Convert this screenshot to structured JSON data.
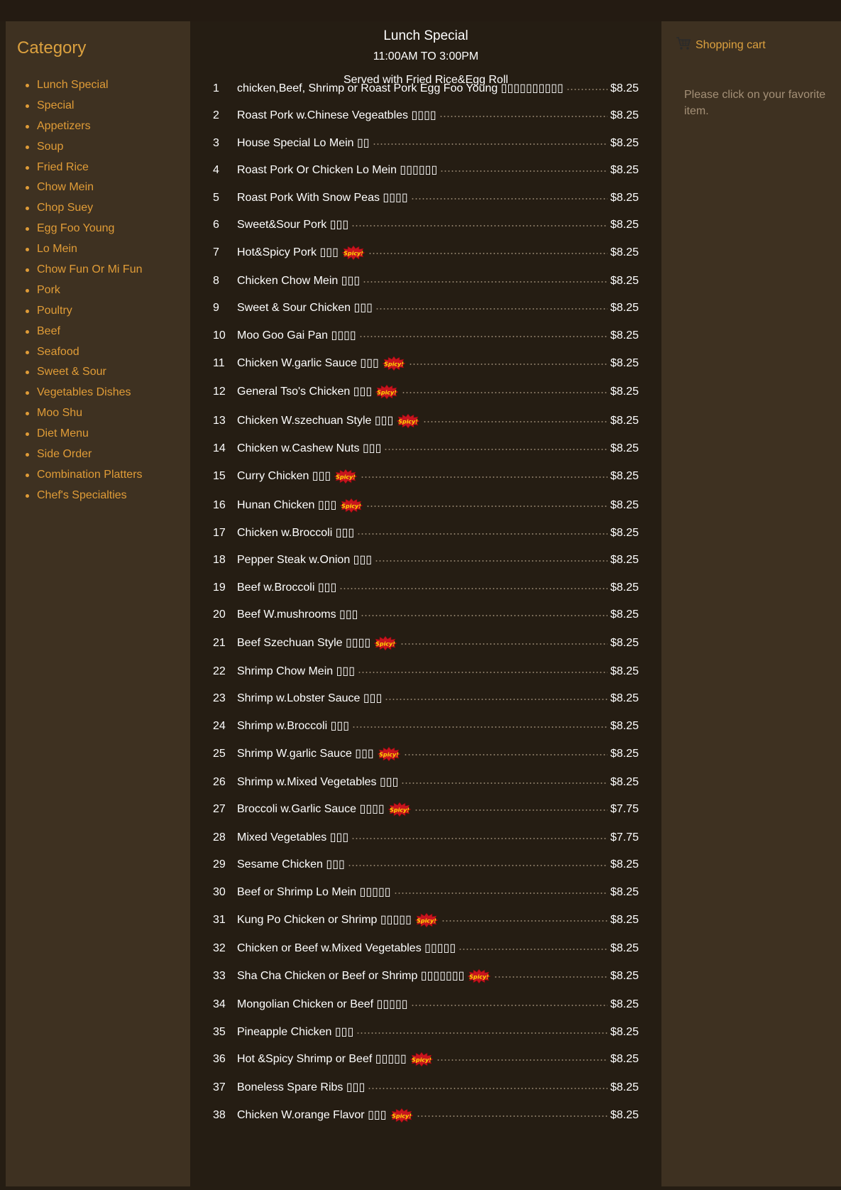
{
  "sidebar": {
    "heading": "Category",
    "items": [
      "Lunch Special",
      "Special",
      "Appetizers",
      "Soup",
      "Fried Rice",
      "Chow Mein",
      "Chop Suey",
      "Egg Foo Young",
      "Lo Mein",
      "Chow Fun Or Mi Fun",
      "Pork",
      "Poultry",
      "Beef",
      "Seafood",
      "Sweet & Sour",
      "Vegetables Dishes",
      "Moo Shu",
      "Diet Menu",
      "Side Order",
      "Combination Platters",
      "Chef's Specialties"
    ]
  },
  "main": {
    "title": "Lunch Special",
    "hours": "11:00AM TO 3:00PM",
    "served": "Served with Fried Rice&Egg Roll",
    "spicy_label": "Spicy!",
    "items": [
      {
        "num": "1",
        "name": "chicken,Beef, Shrimp or Roast Pork Egg Foo Young ▯▯▯▯▯▯▯▯▯▯",
        "price": "$8.25",
        "spicy": false
      },
      {
        "num": "2",
        "name": "Roast Pork w.Chinese Vegeatbles ▯▯▯▯",
        "price": "$8.25",
        "spicy": false
      },
      {
        "num": "3",
        "name": "House Special Lo Mein ▯▯",
        "price": "$8.25",
        "spicy": false
      },
      {
        "num": "4",
        "name": "Roast Pork Or Chicken Lo Mein ▯▯▯▯▯▯",
        "price": "$8.25",
        "spicy": false
      },
      {
        "num": "5",
        "name": "Roast Pork With Snow Peas ▯▯▯▯",
        "price": "$8.25",
        "spicy": false
      },
      {
        "num": "6",
        "name": "Sweet&Sour Pork ▯▯▯",
        "price": "$8.25",
        "spicy": false
      },
      {
        "num": "7",
        "name": "Hot&Spicy Pork ▯▯▯",
        "price": "$8.25",
        "spicy": true
      },
      {
        "num": "8",
        "name": "Chicken Chow Mein ▯▯▯",
        "price": "$8.25",
        "spicy": false
      },
      {
        "num": "9",
        "name": "Sweet & Sour Chicken ▯▯▯",
        "price": "$8.25",
        "spicy": false
      },
      {
        "num": "10",
        "name": "Moo Goo Gai Pan ▯▯▯▯",
        "price": "$8.25",
        "spicy": false
      },
      {
        "num": "11",
        "name": "Chicken W.garlic Sauce ▯▯▯",
        "price": "$8.25",
        "spicy": true
      },
      {
        "num": "12",
        "name": "General Tso's Chicken ▯▯▯",
        "price": "$8.25",
        "spicy": true
      },
      {
        "num": "13",
        "name": "Chicken W.szechuan Style ▯▯▯",
        "price": "$8.25",
        "spicy": true
      },
      {
        "num": "14",
        "name": "Chicken w.Cashew Nuts ▯▯▯",
        "price": "$8.25",
        "spicy": false
      },
      {
        "num": "15",
        "name": "Curry Chicken ▯▯▯",
        "price": "$8.25",
        "spicy": true
      },
      {
        "num": "16",
        "name": "Hunan Chicken ▯▯▯",
        "price": "$8.25",
        "spicy": true
      },
      {
        "num": "17",
        "name": "Chicken w.Broccoli ▯▯▯",
        "price": "$8.25",
        "spicy": false
      },
      {
        "num": "18",
        "name": "Pepper Steak w.Onion ▯▯▯",
        "price": "$8.25",
        "spicy": false
      },
      {
        "num": "19",
        "name": "Beef w.Broccoli ▯▯▯",
        "price": "$8.25",
        "spicy": false
      },
      {
        "num": "20",
        "name": "Beef W.mushrooms ▯▯▯",
        "price": "$8.25",
        "spicy": false
      },
      {
        "num": "21",
        "name": "Beef Szechuan Style ▯▯▯▯",
        "price": "$8.25",
        "spicy": true
      },
      {
        "num": "22",
        "name": "Shrimp Chow Mein ▯▯▯",
        "price": "$8.25",
        "spicy": false
      },
      {
        "num": "23",
        "name": "Shrimp w.Lobster Sauce ▯▯▯",
        "price": "$8.25",
        "spicy": false
      },
      {
        "num": "24",
        "name": "Shrimp w.Broccoli ▯▯▯",
        "price": "$8.25",
        "spicy": false
      },
      {
        "num": "25",
        "name": "Shrimp W.garlic Sauce ▯▯▯",
        "price": "$8.25",
        "spicy": true
      },
      {
        "num": "26",
        "name": "Shrimp w.Mixed Vegetables ▯▯▯",
        "price": "$8.25",
        "spicy": false
      },
      {
        "num": "27",
        "name": "Broccoli w.Garlic Sauce ▯▯▯▯",
        "price": "$7.75",
        "spicy": true
      },
      {
        "num": "28",
        "name": "Mixed Vegetables ▯▯▯",
        "price": "$7.75",
        "spicy": false
      },
      {
        "num": "29",
        "name": "Sesame Chicken ▯▯▯",
        "price": "$8.25",
        "spicy": false
      },
      {
        "num": "30",
        "name": "Beef or Shrimp Lo Mein ▯▯▯▯▯",
        "price": "$8.25",
        "spicy": false
      },
      {
        "num": "31",
        "name": "Kung Po Chicken or Shrimp ▯▯▯▯▯",
        "price": "$8.25",
        "spicy": true
      },
      {
        "num": "32",
        "name": "Chicken or Beef w.Mixed Vegetables ▯▯▯▯▯",
        "price": "$8.25",
        "spicy": false
      },
      {
        "num": "33",
        "name": "Sha Cha Chicken or Beef or Shrimp ▯▯▯▯▯▯▯",
        "price": "$8.25",
        "spicy": true
      },
      {
        "num": "34",
        "name": "Mongolian Chicken or Beef ▯▯▯▯▯",
        "price": "$8.25",
        "spicy": false
      },
      {
        "num": "35",
        "name": "Pineapple Chicken ▯▯▯",
        "price": "$8.25",
        "spicy": false
      },
      {
        "num": "36",
        "name": "Hot &Spicy Shrimp or Beef ▯▯▯▯▯",
        "price": "$8.25",
        "spicy": true
      },
      {
        "num": "37",
        "name": "Boneless Spare Ribs ▯▯▯",
        "price": "$8.25",
        "spicy": false
      },
      {
        "num": "38",
        "name": "Chicken W.orange Flavor ▯▯▯",
        "price": "$8.25",
        "spicy": true
      }
    ]
  },
  "cart": {
    "label": "Shopping cart",
    "icon": "shopping-cart-icon",
    "message": "Please click on your favorite item."
  },
  "colors": {
    "accent": "#dca13f",
    "panel": "#3e3121",
    "background": "#251d13",
    "spicy_red": "#c8141e",
    "spicy_text": "#ffd700"
  }
}
